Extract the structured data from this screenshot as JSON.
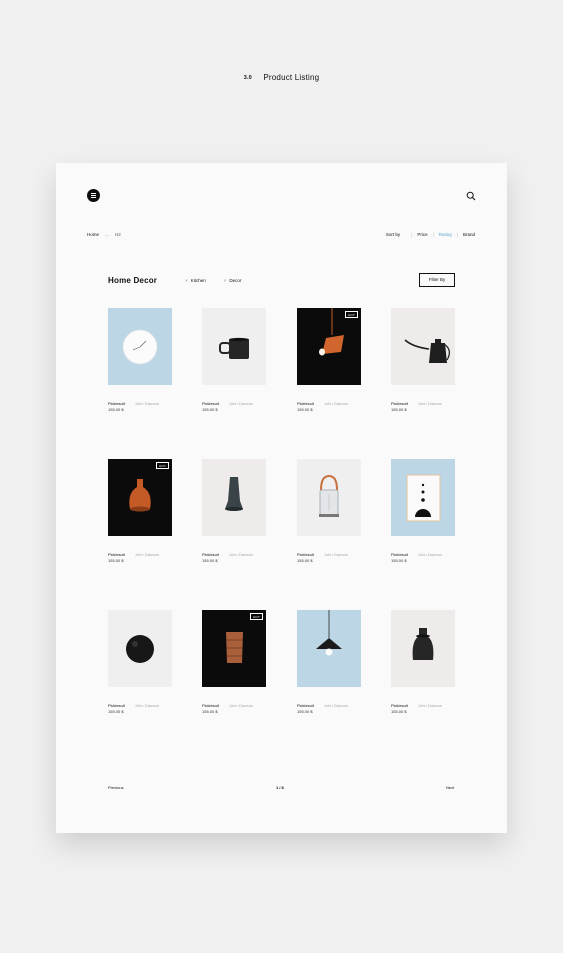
{
  "page_header": {
    "number": "3.0",
    "title": "Product Listing"
  },
  "breadcrumb": {
    "home": "Home",
    "separator": "—",
    "current": "H2"
  },
  "sort": {
    "label": "Sort by",
    "options": [
      "Price",
      "Rating",
      "Brand"
    ],
    "active": "Rating"
  },
  "category": {
    "title": "Home Decor",
    "tags": [
      "Kitchen",
      "Decor"
    ],
    "tag_remove_glyph": "×"
  },
  "filter_label": "Filter By",
  "colors": {
    "accent": "#5fa6d2",
    "light_blue": "#bcd6e6",
    "light_gray": "#efefef",
    "pink_gray": "#efebeb",
    "black": "#0b0b0b",
    "copper": "#d0662e"
  },
  "products": [
    {
      "name": "Picklesuit",
      "brand": "John Dawson",
      "price": "155.00 $",
      "image": "wall-clock",
      "bg": "#bcd6e6",
      "badge": ""
    },
    {
      "name": "Picklesuit",
      "brand": "John Dawson",
      "price": "155.00 $",
      "image": "coffee-mug",
      "bg": "#efefef",
      "badge": ""
    },
    {
      "name": "Picklesuit",
      "brand": "John Dawson",
      "price": "155.00 $",
      "image": "pendant-lamp",
      "bg": "#0b0b0b",
      "badge": "HOT"
    },
    {
      "name": "Picklesuit",
      "brand": "John Dawson",
      "price": "155.00 $",
      "image": "kettle",
      "bg": "#efebeb",
      "badge": ""
    },
    {
      "name": "Picklesuit",
      "brand": "John Dawson",
      "price": "155.00 $",
      "image": "copper-vase",
      "bg": "#0b0b0b",
      "badge": "HOT"
    },
    {
      "name": "Picklesuit",
      "brand": "John Dawson",
      "price": "155.00 $",
      "image": "glass-vase",
      "bg": "#efebeb",
      "badge": ""
    },
    {
      "name": "Picklesuit",
      "brand": "John Dawson",
      "price": "155.00 $",
      "image": "lantern",
      "bg": "#efefef",
      "badge": ""
    },
    {
      "name": "Picklesuit",
      "brand": "John Dawson",
      "price": "155.00 $",
      "image": "art-print",
      "bg": "#bcd6e6",
      "badge": ""
    },
    {
      "name": "Picklesuit",
      "brand": "John Dawson",
      "price": "155.00 $",
      "image": "ball",
      "bg": "#efefef",
      "badge": ""
    },
    {
      "name": "Picklesuit",
      "brand": "John Dawson",
      "price": "155.00 $",
      "image": "wood-cup",
      "bg": "#0b0b0b",
      "badge": "HOT"
    },
    {
      "name": "Picklesuit",
      "brand": "John Dawson",
      "price": "155.00 $",
      "image": "cone-lamp",
      "bg": "#bcd6e6",
      "badge": ""
    },
    {
      "name": "Picklesuit",
      "brand": "John Dawson",
      "price": "155.00 $",
      "image": "bottle-vase",
      "bg": "#efebeb",
      "badge": ""
    }
  ],
  "pagination": {
    "previous": "Previous",
    "next": "Next",
    "page": "1 / 8"
  }
}
